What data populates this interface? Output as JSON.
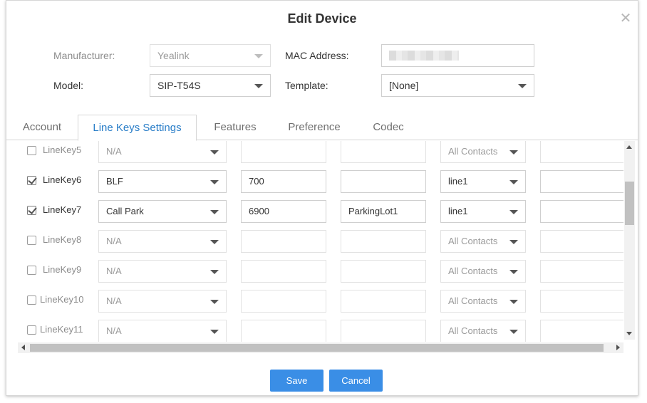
{
  "dialog": {
    "title": "Edit Device",
    "close_glyph": "✕"
  },
  "form": {
    "manufacturer": {
      "label": "Manufacturer:",
      "value": "Yealink"
    },
    "mac": {
      "label": "MAC Address:"
    },
    "model": {
      "label": "Model:",
      "value": "SIP-T54S"
    },
    "template": {
      "label": "Template:",
      "value": "[None]"
    }
  },
  "tabs": [
    "Account",
    "Line Keys Settings",
    "Features",
    "Preference",
    "Codec"
  ],
  "active_tab": "Line Keys Settings",
  "linekeys": [
    {
      "label": "LineKey5",
      "checked": false,
      "type": "N/A",
      "value": "",
      "label2": "",
      "line": "All Contacts"
    },
    {
      "label": "LineKey6",
      "checked": true,
      "type": "BLF",
      "value": "700",
      "label2": "",
      "line": "line1"
    },
    {
      "label": "LineKey7",
      "checked": true,
      "type": "Call Park",
      "value": "6900",
      "label2": "ParkingLot1",
      "line": "line1"
    },
    {
      "label": "LineKey8",
      "checked": false,
      "type": "N/A",
      "value": "",
      "label2": "",
      "line": "All Contacts"
    },
    {
      "label": "LineKey9",
      "checked": false,
      "type": "N/A",
      "value": "",
      "label2": "",
      "line": "All Contacts"
    },
    {
      "label": "LineKey10",
      "checked": false,
      "type": "N/A",
      "value": "",
      "label2": "",
      "line": "All Contacts"
    },
    {
      "label": "LineKey11",
      "checked": false,
      "type": "N/A",
      "value": "",
      "label2": "",
      "line": "All Contacts"
    }
  ],
  "buttons": {
    "save": "Save",
    "cancel": "Cancel"
  },
  "colors": {
    "accent": "#3a8ee6",
    "active_tab_text": "#2a7ec8"
  }
}
